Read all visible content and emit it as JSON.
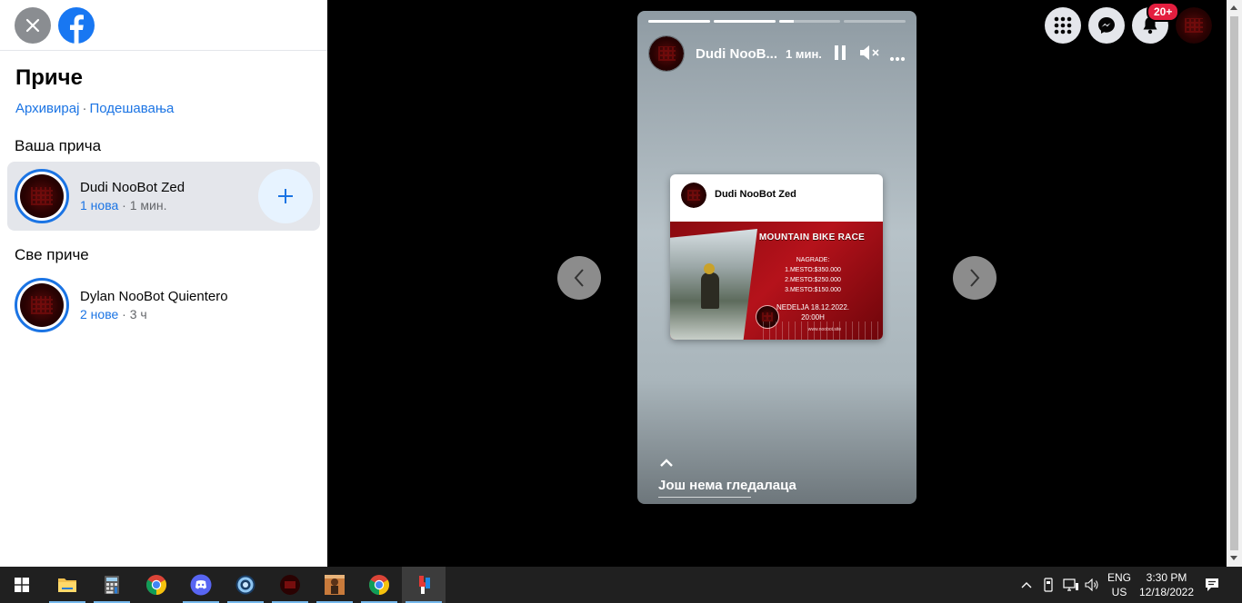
{
  "sidebar": {
    "title": "Приче",
    "links": {
      "archive": "Архивирај",
      "separator": "·",
      "settings": "Подешавања"
    },
    "your_story_heading": "Ваша прича",
    "your_story": {
      "name": "Dudi NooBot Zed",
      "new_count": "1 нова",
      "separator": "·",
      "time": "1 мин."
    },
    "all_stories_heading": "Све приче",
    "stories": [
      {
        "name": "Dylan NooBot Quientero",
        "new_count": "2 нове",
        "separator": "·",
        "time": "3 ч"
      }
    ]
  },
  "topbar": {
    "icons": [
      "apps-grid-icon",
      "messenger-icon",
      "bell-icon"
    ],
    "notification_badge": "20+"
  },
  "story_viewer": {
    "progress": [
      1.0,
      1.0,
      0.25,
      0.0
    ],
    "author": "Dudi NooB...",
    "time": "1 мин.",
    "post": {
      "author": "Dudi NooBot Zed",
      "poster_title": "MOUNTAIN BIKE RACE",
      "lines": [
        "NAGRADE:",
        "1.MESTO:$350.000",
        "2.MESTO:$250.000",
        "3.MESTO:$150.000",
        "NEDELJA 18.12.2022.",
        "20:00H"
      ],
      "url": "www.noobot.site"
    },
    "viewers_text": "Још нема гледалаца"
  },
  "taskbar": {
    "apps": [
      "windows-start",
      "file-explorer",
      "calculator",
      "chrome",
      "discord",
      "blue-app",
      "red-app",
      "game-app",
      "chrome",
      "paint-app"
    ],
    "language": "ENG",
    "region": "US",
    "time": "3:30 PM",
    "date": "12/18/2022"
  },
  "colors": {
    "accent": "#1b74e4",
    "badge": "#e41e3f",
    "facebook": "#1877f2"
  }
}
